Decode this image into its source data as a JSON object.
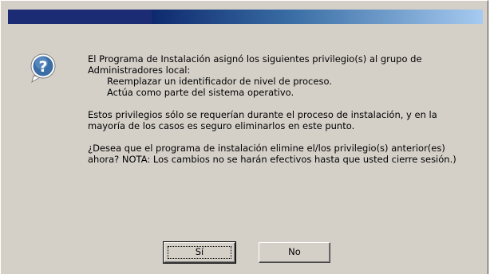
{
  "window": {
    "title": ""
  },
  "icon": {
    "name": "question-icon",
    "glyph": "?"
  },
  "message": {
    "para1_line1": "El Programa de Instalación asignó los siguientes privilegio(s) al grupo de Administradores local:",
    "privileges": [
      "Reemplazar un identificador de nivel de proceso.",
      "Actúa como parte del sistema operativo."
    ],
    "para2": "Estos privilegios sólo se requerían durante el proceso de instalación, y en la mayoría de los casos es seguro eliminarlos en este punto.",
    "para3": "¿Desea que el programa de instalación elimine el/los privilegio(s) anterior(es) ahora?  NOTA: Los cambios no se harán efectivos hasta que usted cierre sesión.)"
  },
  "buttons": {
    "yes_label": "Sí",
    "no_label": "No"
  },
  "colors": {
    "dialog_bg": "#d4d0c8",
    "title_start": "#0a246a",
    "title_end": "#a6caf0",
    "icon_bg": "#3a6ea5"
  }
}
